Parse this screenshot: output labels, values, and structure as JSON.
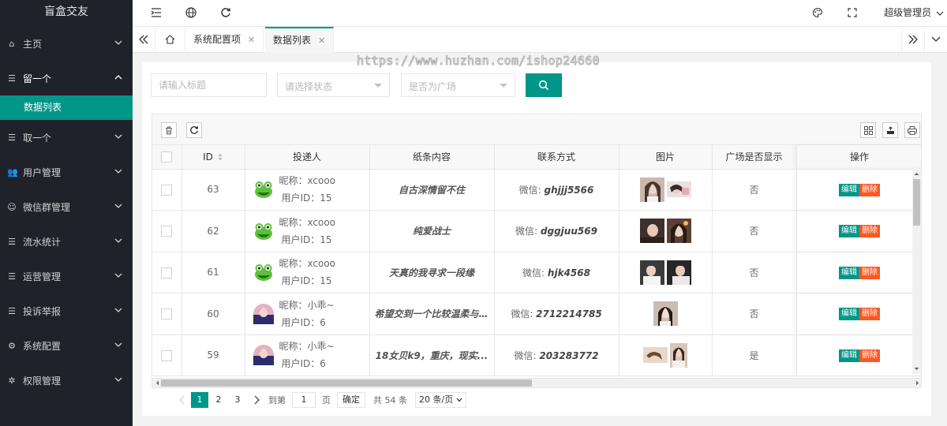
{
  "app": {
    "title": "盲盒交友"
  },
  "header": {
    "user_label": "超级管理员"
  },
  "sidebar": {
    "items": [
      {
        "label": "主页",
        "icon": "home-icon"
      },
      {
        "label": "留一个",
        "icon": "list-icon",
        "open": true
      },
      {
        "label": "取一个",
        "icon": "list-icon"
      },
      {
        "label": "用户管理",
        "icon": "users-icon"
      },
      {
        "label": "微信群管理",
        "icon": "wechat-icon"
      },
      {
        "label": "流水统计",
        "icon": "list-icon"
      },
      {
        "label": "运营管理",
        "icon": "list-icon"
      },
      {
        "label": "投诉举报",
        "icon": "list-icon"
      },
      {
        "label": "系统配置",
        "icon": "settings-icon"
      },
      {
        "label": "权限管理",
        "icon": "gear-icon"
      }
    ],
    "subitem": {
      "label": "数据列表"
    }
  },
  "tabs": [
    {
      "label": "系统配置项"
    },
    {
      "label": "数据列表",
      "active": true
    }
  ],
  "watermark": "https://www.huzhan.com/ishop24660",
  "filters": {
    "title_placeholder": "请输入标题",
    "status_placeholder": "请选择状态",
    "plaza_placeholder": "是否为广场"
  },
  "table": {
    "columns": [
      "ID",
      "投递人",
      "纸条内容",
      "联系方式",
      "图片",
      "广场是否显示",
      "操作"
    ],
    "rows": [
      {
        "id": "63",
        "nickname": "昵称：xcooo",
        "userid": "用户ID：15",
        "content": "自古深情留不住",
        "contact_prefix": "微信: ",
        "contact": "ghjjj5566",
        "plaza": "否",
        "avatar": "frog"
      },
      {
        "id": "62",
        "nickname": "昵称：xcooo",
        "userid": "用户ID：15",
        "content": "纯爱战士",
        "contact_prefix": "微信: ",
        "contact": "dggjuu569",
        "plaza": "否",
        "avatar": "frog"
      },
      {
        "id": "61",
        "nickname": "昵称：xcooo",
        "userid": "用户ID：15",
        "content": "天真的我寻求一段缘",
        "contact_prefix": "微信: ",
        "contact": "hjk4568",
        "plaza": "否",
        "avatar": "frog"
      },
      {
        "id": "60",
        "nickname": "昵称：小乖~",
        "userid": "用户ID：6",
        "content": "希望交到一个比较温柔与...",
        "contact_prefix": "微信: ",
        "contact": "2712214785",
        "plaza": "否",
        "avatar": "girl"
      },
      {
        "id": "59",
        "nickname": "昵称：小乖~",
        "userid": "用户ID：6",
        "content": "18女贝k9，重庆，现实...",
        "contact_prefix": "微信: ",
        "contact": "203283772",
        "plaza": "是",
        "avatar": "girl"
      }
    ],
    "edit_label": "编辑",
    "delete_label": "删除"
  },
  "pagination": {
    "pages": [
      "1",
      "2",
      "3"
    ],
    "current": "1",
    "goto_label": "到第",
    "goto_value": "1",
    "page_unit": "页",
    "confirm_label": "确定",
    "total_label": "共 54 条",
    "page_size_label": "20 条/页"
  },
  "colors": {
    "accent": "#009688",
    "danger": "#ff5722",
    "sidebar": "#20222a"
  }
}
